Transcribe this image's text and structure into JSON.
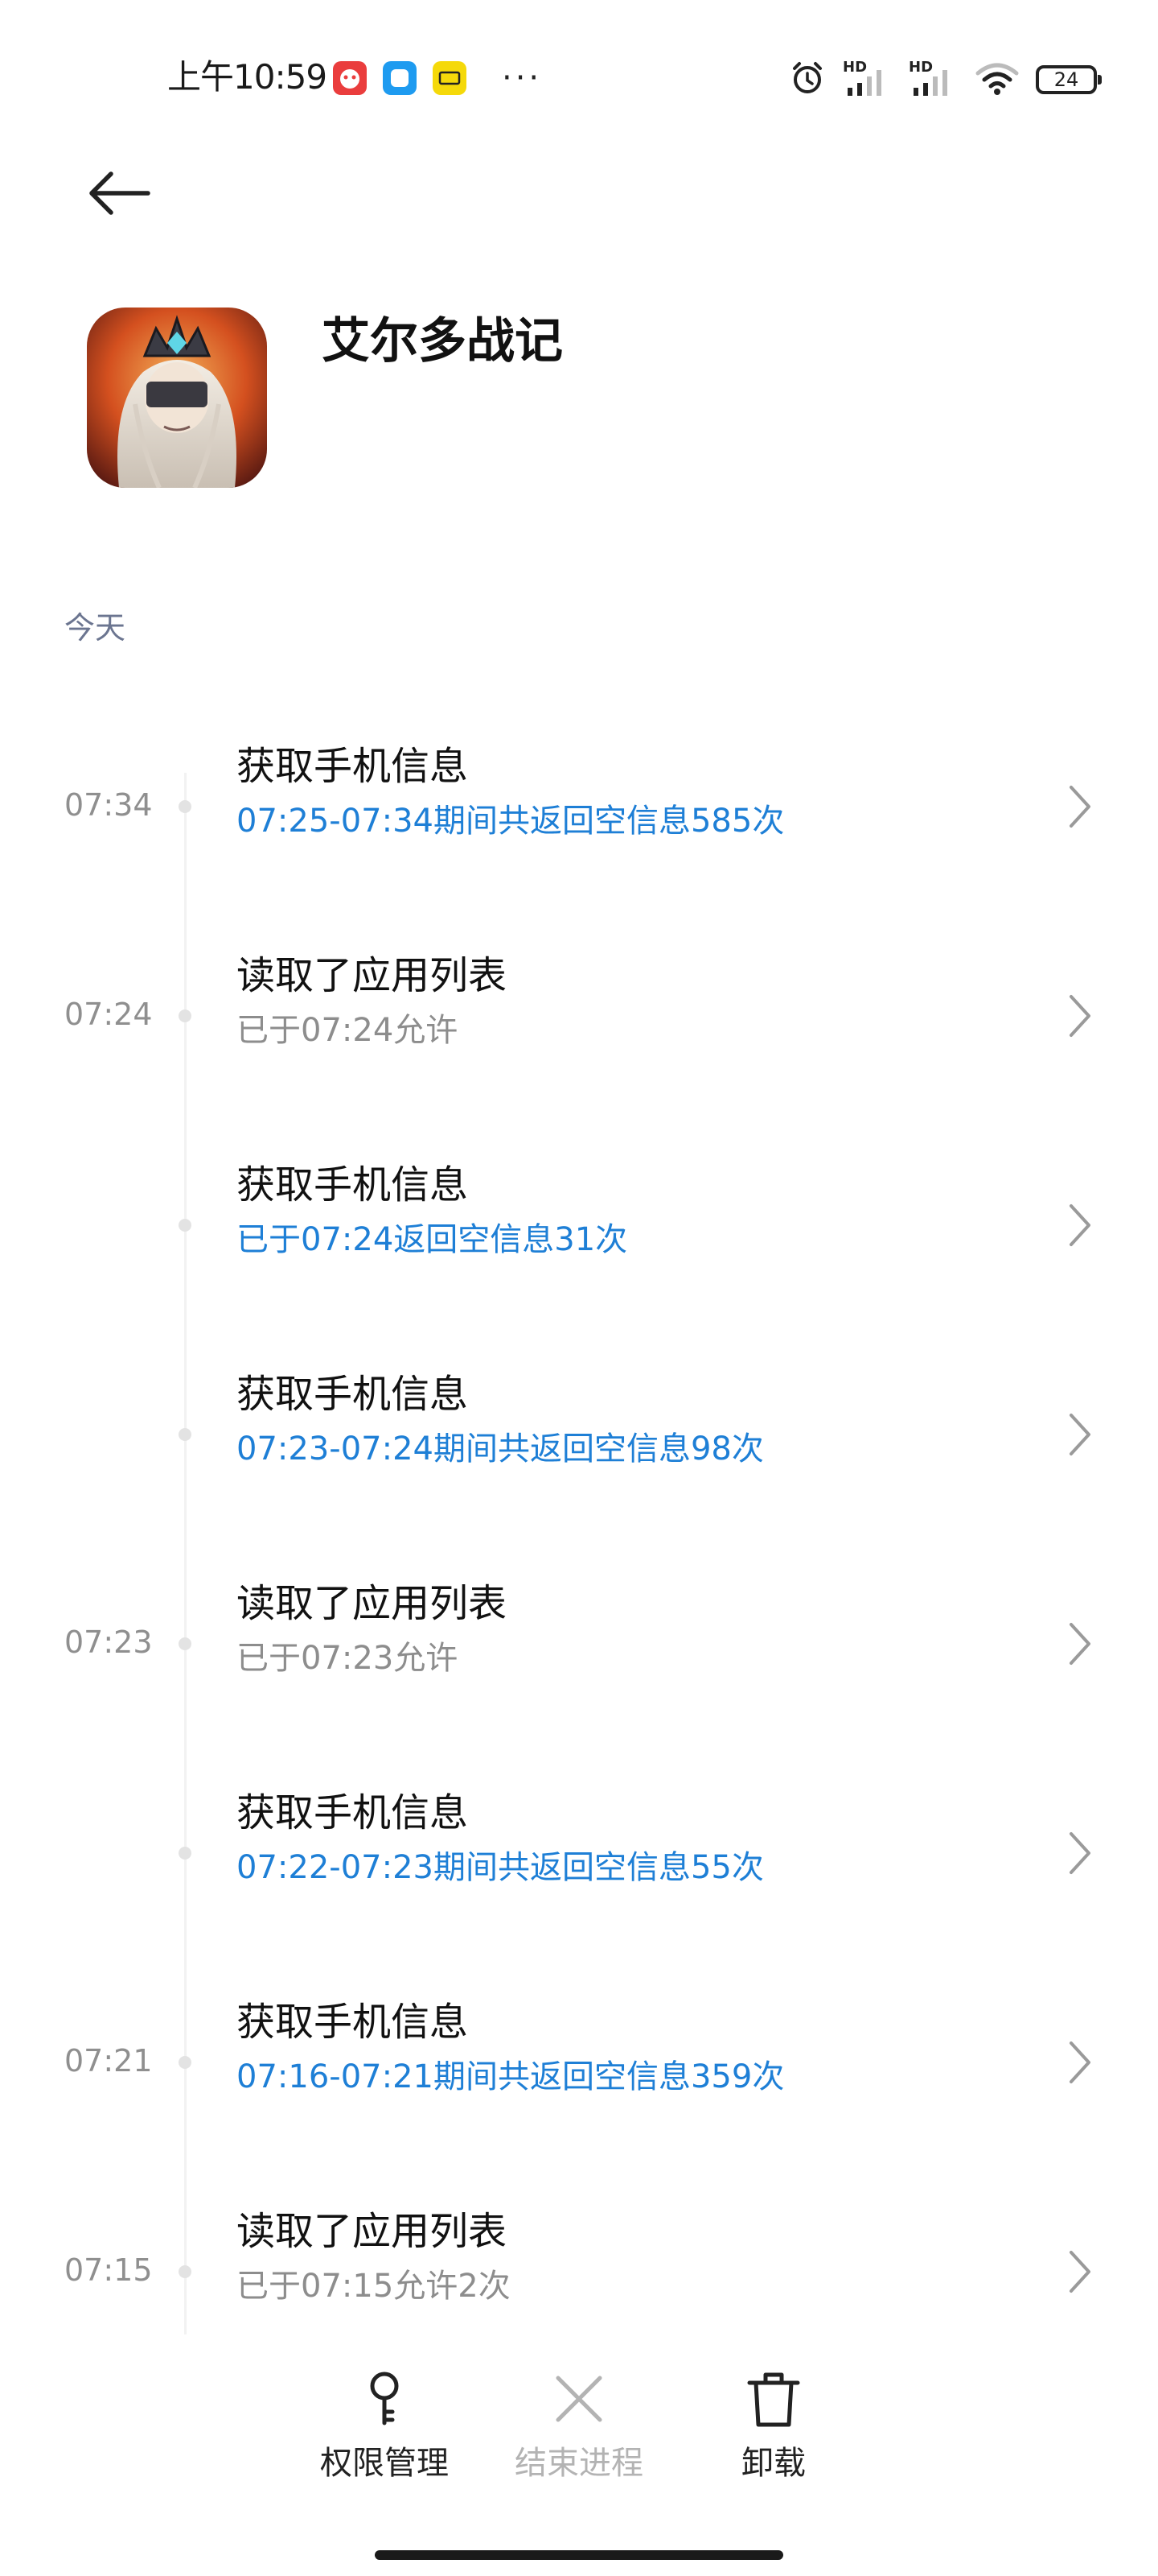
{
  "status_bar": {
    "time": "上午10:59",
    "more": "···",
    "network_1": "HD",
    "network_2": "HD",
    "battery": "24"
  },
  "app": {
    "name": "艾尔多战记"
  },
  "section": {
    "title": "今天"
  },
  "timeline": [
    {
      "time": "07:34",
      "title": "获取手机信息",
      "detail": "07:25-07:34期间共返回空信息585次",
      "detail_color": "blue"
    },
    {
      "time": "07:24",
      "title": "读取了应用列表",
      "detail": "已于07:24允许",
      "detail_color": "gray"
    },
    {
      "time": "",
      "title": "获取手机信息",
      "detail": "已于07:24返回空信息31次",
      "detail_color": "blue"
    },
    {
      "time": "",
      "title": "获取手机信息",
      "detail": "07:23-07:24期间共返回空信息98次",
      "detail_color": "blue"
    },
    {
      "time": "07:23",
      "title": "读取了应用列表",
      "detail": "已于07:23允许",
      "detail_color": "gray"
    },
    {
      "time": "",
      "title": "获取手机信息",
      "detail": "07:22-07:23期间共返回空信息55次",
      "detail_color": "blue"
    },
    {
      "time": "07:21",
      "title": "获取手机信息",
      "detail": "07:16-07:21期间共返回空信息359次",
      "detail_color": "blue"
    },
    {
      "time": "07:15",
      "title": "读取了应用列表",
      "detail": "已于07:15允许2次",
      "detail_color": "gray"
    }
  ],
  "bottom_bar": {
    "permissions": "权限管理",
    "end_process": "结束进程",
    "uninstall": "卸载"
  },
  "colors": {
    "accent_blue": "#1e7fd6",
    "muted_gray": "#8d8d8d",
    "section_title": "#6b7590"
  }
}
